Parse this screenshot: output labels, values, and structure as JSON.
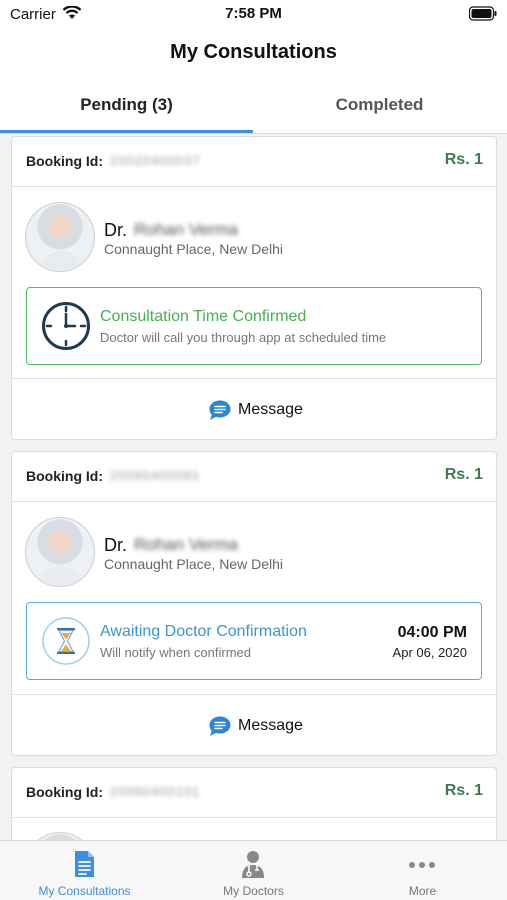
{
  "status_bar": {
    "carrier": "Carrier",
    "time": "7:58 PM"
  },
  "header": {
    "title": "My Consultations"
  },
  "tabs": {
    "pending": "Pending (3)",
    "completed": "Completed",
    "active": "pending"
  },
  "consultations": [
    {
      "booking_label": "Booking Id:",
      "booking_id": "20020400037",
      "price": "Rs. 1",
      "doctor_prefix": "Dr.",
      "doctor_name": "Rohan Verma",
      "location": "Connaught Place, New Delhi",
      "status_icon": "clock-icon",
      "status_title": "Consultation Time Confirmed",
      "status_subtitle": "Doctor will call you through app at scheduled time",
      "message_label": "Message"
    },
    {
      "booking_label": "Booking Id:",
      "booking_id": "20060400091",
      "price": "Rs. 1",
      "doctor_prefix": "Dr.",
      "doctor_name": "Rohan Verma",
      "location": "Connaught Place, New Delhi",
      "status_icon": "hourglass-icon",
      "status_title": "Awaiting Doctor Confirmation",
      "status_subtitle": "Will notify when confirmed",
      "appointment_time": "04:00 PM",
      "appointment_date": "Apr 06, 2020",
      "message_label": "Message"
    },
    {
      "booking_label": "Booking Id:",
      "booking_id": "20060400101",
      "price": "Rs. 1"
    }
  ],
  "bottom_nav": {
    "items": [
      {
        "label": "My Consultations",
        "icon": "document-icon",
        "active": true
      },
      {
        "label": "My Doctors",
        "icon": "doctor-icon",
        "active": false
      },
      {
        "label": "More",
        "icon": "more-dots-icon",
        "active": false
      }
    ]
  },
  "colors": {
    "accent_blue": "#3a8ee6",
    "confirmed_green": "#46b04f",
    "price_green": "#3b7b4e",
    "awaiting_blue": "#3b95d4"
  }
}
